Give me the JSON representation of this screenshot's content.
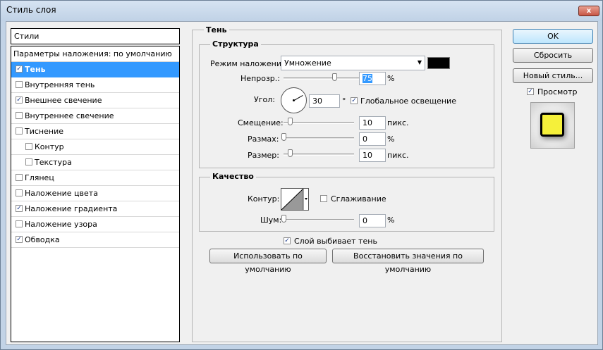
{
  "window": {
    "title": "Стиль слоя",
    "close_label": "x"
  },
  "styles_panel": {
    "header": "Стили",
    "blend_options": "Параметры наложения: по умолчанию",
    "items": [
      {
        "label": "Тень",
        "checked": true,
        "selected": true
      },
      {
        "label": "Внутренняя тень",
        "checked": false
      },
      {
        "label": "Внешнее свечение",
        "checked": true
      },
      {
        "label": "Внутреннее свечение",
        "checked": false
      },
      {
        "label": "Тиснение",
        "checked": false
      },
      {
        "label": "Контур",
        "checked": false
      },
      {
        "label": "Текстура",
        "checked": false
      },
      {
        "label": "Глянец",
        "checked": false
      },
      {
        "label": "Наложение цвета",
        "checked": false
      },
      {
        "label": "Наложение градиента",
        "checked": true
      },
      {
        "label": "Наложение узора",
        "checked": false
      },
      {
        "label": "Обводка",
        "checked": true
      }
    ]
  },
  "shadow": {
    "title": "Тень",
    "structure": {
      "title": "Структура",
      "blend_mode_label": "Режим наложения:",
      "blend_mode_value": "Умножение",
      "color": "#000000",
      "opacity_label": "Непрозр.:",
      "opacity_value": "75",
      "opacity_unit": "%",
      "opacity_level": 0.75,
      "angle_label": "Угол:",
      "angle_value": "30",
      "angle_unit": "°",
      "global_light_label": "Глобальное освещение",
      "global_light_checked": true,
      "distance_label": "Смещение:",
      "distance_value": "10",
      "distance_unit": "пикс.",
      "spread_label": "Размах:",
      "spread_value": "0",
      "spread_unit": "%",
      "size_label": "Размер:",
      "size_value": "10",
      "size_unit": "пикс."
    },
    "quality": {
      "title": "Качество",
      "contour_label": "Контур:",
      "antialias_label": "Сглаживание",
      "antialias_checked": false,
      "noise_label": "Шум:",
      "noise_value": "0",
      "noise_unit": "%"
    },
    "knockout_label": "Слой выбивает тень",
    "knockout_checked": true,
    "make_default_label": "Использовать по умолчанию",
    "reset_default_label": "Восстановить значения по умолчанию"
  },
  "buttons": {
    "ok": "OK",
    "reset": "Сбросить",
    "new_style": "Новый стиль...",
    "preview_label": "Просмотр",
    "preview_checked": true
  },
  "colors": {
    "selection": "#3399ff",
    "preview_fill": "#f5f03a"
  }
}
